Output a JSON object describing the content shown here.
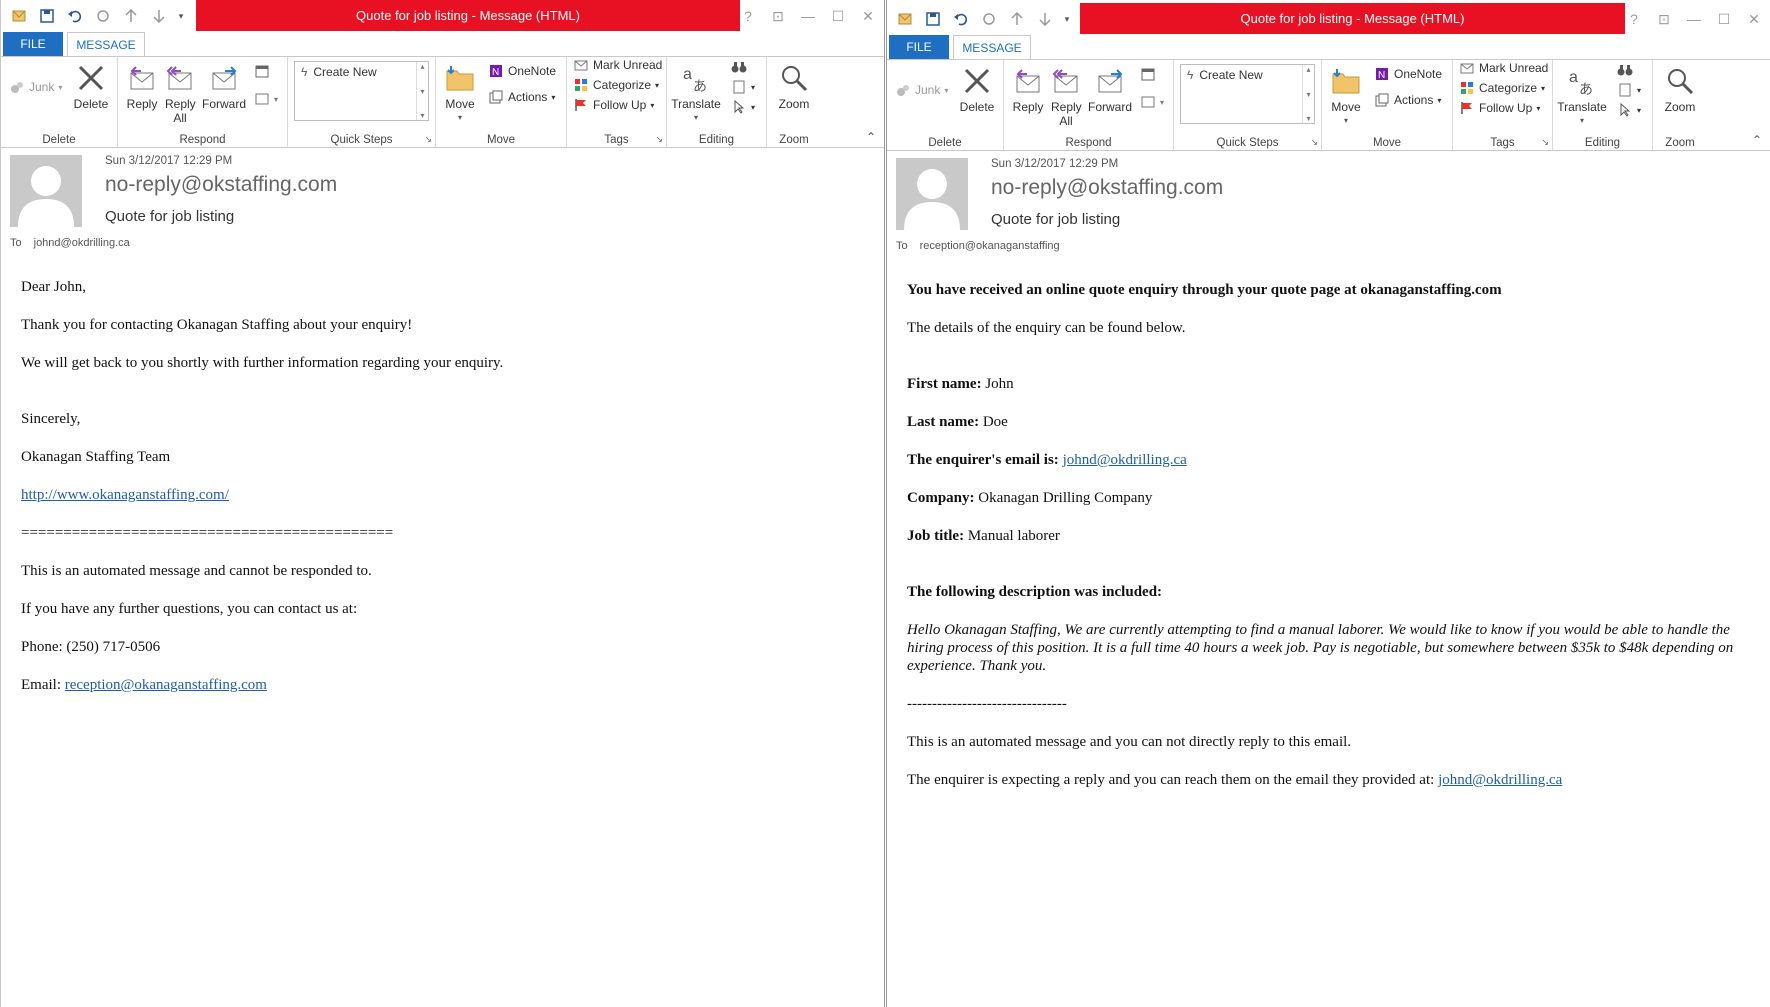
{
  "ribbon": {
    "tab_file": "FILE",
    "tab_message": "MESSAGE",
    "junk": "Junk",
    "delete": "Delete",
    "reply": "Reply",
    "reply_all": "Reply All",
    "forward": "Forward",
    "create_new": "Create New",
    "move": "Move",
    "onenote": "OneNote",
    "actions": "Actions",
    "mark_unread": "Mark Unread",
    "categorize": "Categorize",
    "follow_up": "Follow Up",
    "translate": "Translate",
    "zoom": "Zoom",
    "groups": {
      "delete": "Delete",
      "respond": "Respond",
      "quick_steps": "Quick Steps",
      "move": "Move",
      "tags": "Tags",
      "editing": "Editing",
      "zoom": "Zoom"
    }
  },
  "left": {
    "title": "Quote for job listing -  Message (HTML)",
    "date": "Sun 3/12/2017 12:29 PM",
    "sender": "no-reply@okstaffing.com",
    "subject": "Quote for job listing",
    "to_label": "To",
    "to": "johnd@okdrilling.ca",
    "body": {
      "greeting": "Dear John,",
      "line1": "Thank you for contacting Okanagan Staffing about your enquiry!",
      "line2": "We will get back to you shortly with further information regarding your enquiry.",
      "sincerely": "Sincerely,",
      "team": "Okanagan Staffing Team",
      "website": "http://www.okanaganstaffing.com/",
      "separator": "============================================",
      "automated": "This is an automated message and cannot be responded to.",
      "further": "If you have any further questions, you can contact us at:",
      "phone": "Phone: (250) 717-0506",
      "email_label": "Email:",
      "email": "reception@okanaganstaffing.com"
    }
  },
  "right": {
    "title": "Quote for job listing -  Message (HTML)",
    "date": "Sun 3/12/2017 12:29 PM",
    "sender": "no-reply@okstaffing.com",
    "subject": "Quote for job listing",
    "to_label": "To",
    "to": "reception@okanaganstaffing",
    "body": {
      "heading": "You have received an online quote enquiry through your quote page at okanaganstaffing.com",
      "details": "The details of the enquiry can be found below.",
      "first_name_label": "First name:",
      "first_name": "John",
      "last_name_label": "Last name:",
      "last_name": "Doe",
      "email_label": "The enquirer's email is:",
      "email": "johnd@okdrilling.ca",
      "company_label": "Company:",
      "company": "Okanagan Drilling Company",
      "job_title_label": "Job title:",
      "job_title": "Manual laborer",
      "desc_label": "The following description was included:",
      "description": "Hello Okanagan Staffing, We are currently attempting to find a manual laborer. We would like to know if you would be able to handle the hiring process of this position. It is a full time 40 hours a week job. Pay is negotiable, but somewhere between $35k to $48k depending on experience. Thank you.",
      "separator": "--------------------------------",
      "automated": "This is an automated message and you can not directly reply to this email.",
      "expecting": "The enquirer is expecting a reply and you can reach them on the email they provided at:",
      "reply_email": "johnd@okdrilling.ca"
    }
  }
}
